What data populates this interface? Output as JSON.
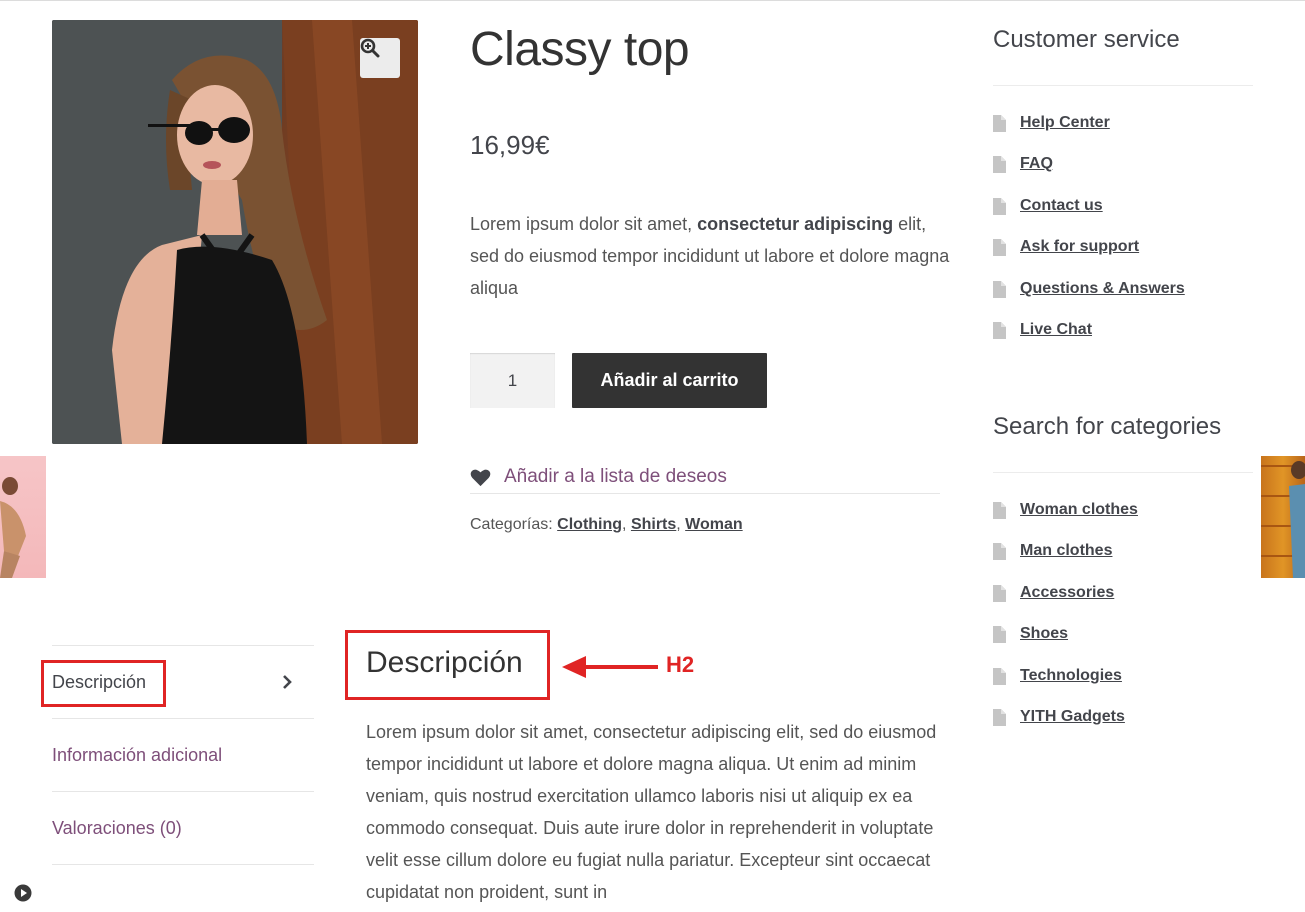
{
  "product": {
    "title": "Classy top",
    "price": "16,99€",
    "description_part1": "Lorem ipsum dolor sit amet, ",
    "description_bold": "consectetur adipiscing",
    "description_part2": " elit, sed do eiusmod tempor incididunt ut labore et dolore magna aliqua",
    "quantity": "1",
    "add_to_cart_label": "Añadir al carrito",
    "wishlist_label": "Añadir a la lista de deseos",
    "categories_label": "Categorías:",
    "categories": [
      "Clothing",
      "Shirts",
      "Woman"
    ],
    "image_icon": "magnifier-zoom-icon"
  },
  "tabs": [
    {
      "label": "Descripción",
      "active": true
    },
    {
      "label": "Información adicional",
      "active": false
    },
    {
      "label": "Valoraciones (0)",
      "active": false
    }
  ],
  "description_section": {
    "heading": "Descripción",
    "annotation": "H2",
    "body": "Lorem ipsum dolor sit amet, consectetur adipiscing elit, sed do eiusmod tempor incididunt ut labore et dolore magna aliqua. Ut enim ad minim veniam, quis nostrud exercitation ullamco laboris nisi ut aliquip ex ea commodo consequat. Duis aute irure dolor in reprehenderit in voluptate velit esse cillum dolore eu fugiat nulla pariatur. Excepteur sint occaecat cupidatat non proident, sunt in"
  },
  "sidebar": {
    "customer_service": {
      "title": "Customer service",
      "items": [
        "Help Center",
        "FAQ",
        "Contact us",
        "Ask for support",
        "Questions & Answers",
        "Live Chat"
      ]
    },
    "categories": {
      "title": "Search for categories",
      "items": [
        "Woman clothes",
        "Man clothes",
        "Accessories",
        "Shoes",
        "Technologies",
        "YITH Gadgets"
      ]
    }
  },
  "colors": {
    "accent_link": "#7e4f7a",
    "button_bg": "#333333",
    "annotation_red": "#e02424",
    "text": "#43454b"
  }
}
